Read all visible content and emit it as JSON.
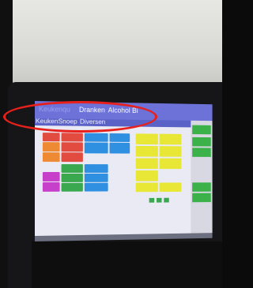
{
  "top_nav": {
    "items": [
      "Keukenqu",
      "Dranken",
      "Alcohol",
      "Bi"
    ]
  },
  "sub_nav": {
    "items": [
      "Keuken",
      "Snoep",
      "Diversen"
    ]
  },
  "annotation_color": "#e8201c",
  "tile_colors": {
    "red": "#e24b3f",
    "orange": "#ef8a34",
    "blue": "#2f8fe0",
    "magenta": "#c640c9",
    "green": "#3aa84f",
    "yellow": "#e9e736"
  }
}
